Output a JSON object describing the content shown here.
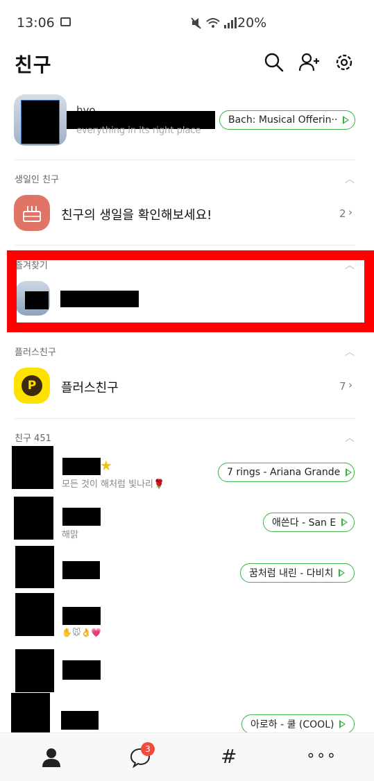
{
  "status_bar": {
    "time": "13:06",
    "battery": "20%",
    "icons": [
      "image-icon",
      "mute-icon",
      "wifi-icon",
      "signal-icon"
    ]
  },
  "header": {
    "title": "친구",
    "icons": [
      "search-icon",
      "add-friend-icon",
      "settings-icon"
    ]
  },
  "profile": {
    "name_partial": "hyo",
    "status_message": "everything in its right place",
    "music": "Bach: Musical Offerin···"
  },
  "birthday": {
    "section_label": "생일인 친구",
    "row_text": "친구의 생일을 확인해보세요!",
    "count": "2"
  },
  "favorites": {
    "section_label": "즐겨찾기"
  },
  "plus_friends": {
    "section_label": "플러스친구",
    "row_text": "플러스친구",
    "count": "7"
  },
  "friends": {
    "section_label": "친구 451",
    "items": [
      {
        "status": "모든 것이 해처럼 빛나리🌹",
        "music": "7 rings - Ariana Grande"
      },
      {
        "status": "해맑",
        "music": "애쓴다 - San E"
      },
      {
        "status": "",
        "music": "꿈처럼 내린 - 다비치"
      },
      {
        "status": "✋🐭👌💗",
        "music": ""
      },
      {
        "status": "",
        "music": ""
      },
      {
        "status": "",
        "music": "아로하 - 쿨 (COOL)"
      }
    ]
  },
  "bottom_nav": {
    "chat_badge": "3",
    "hash_label": "#",
    "more_label": "∘∘∘",
    "accent": "#3cb043"
  }
}
